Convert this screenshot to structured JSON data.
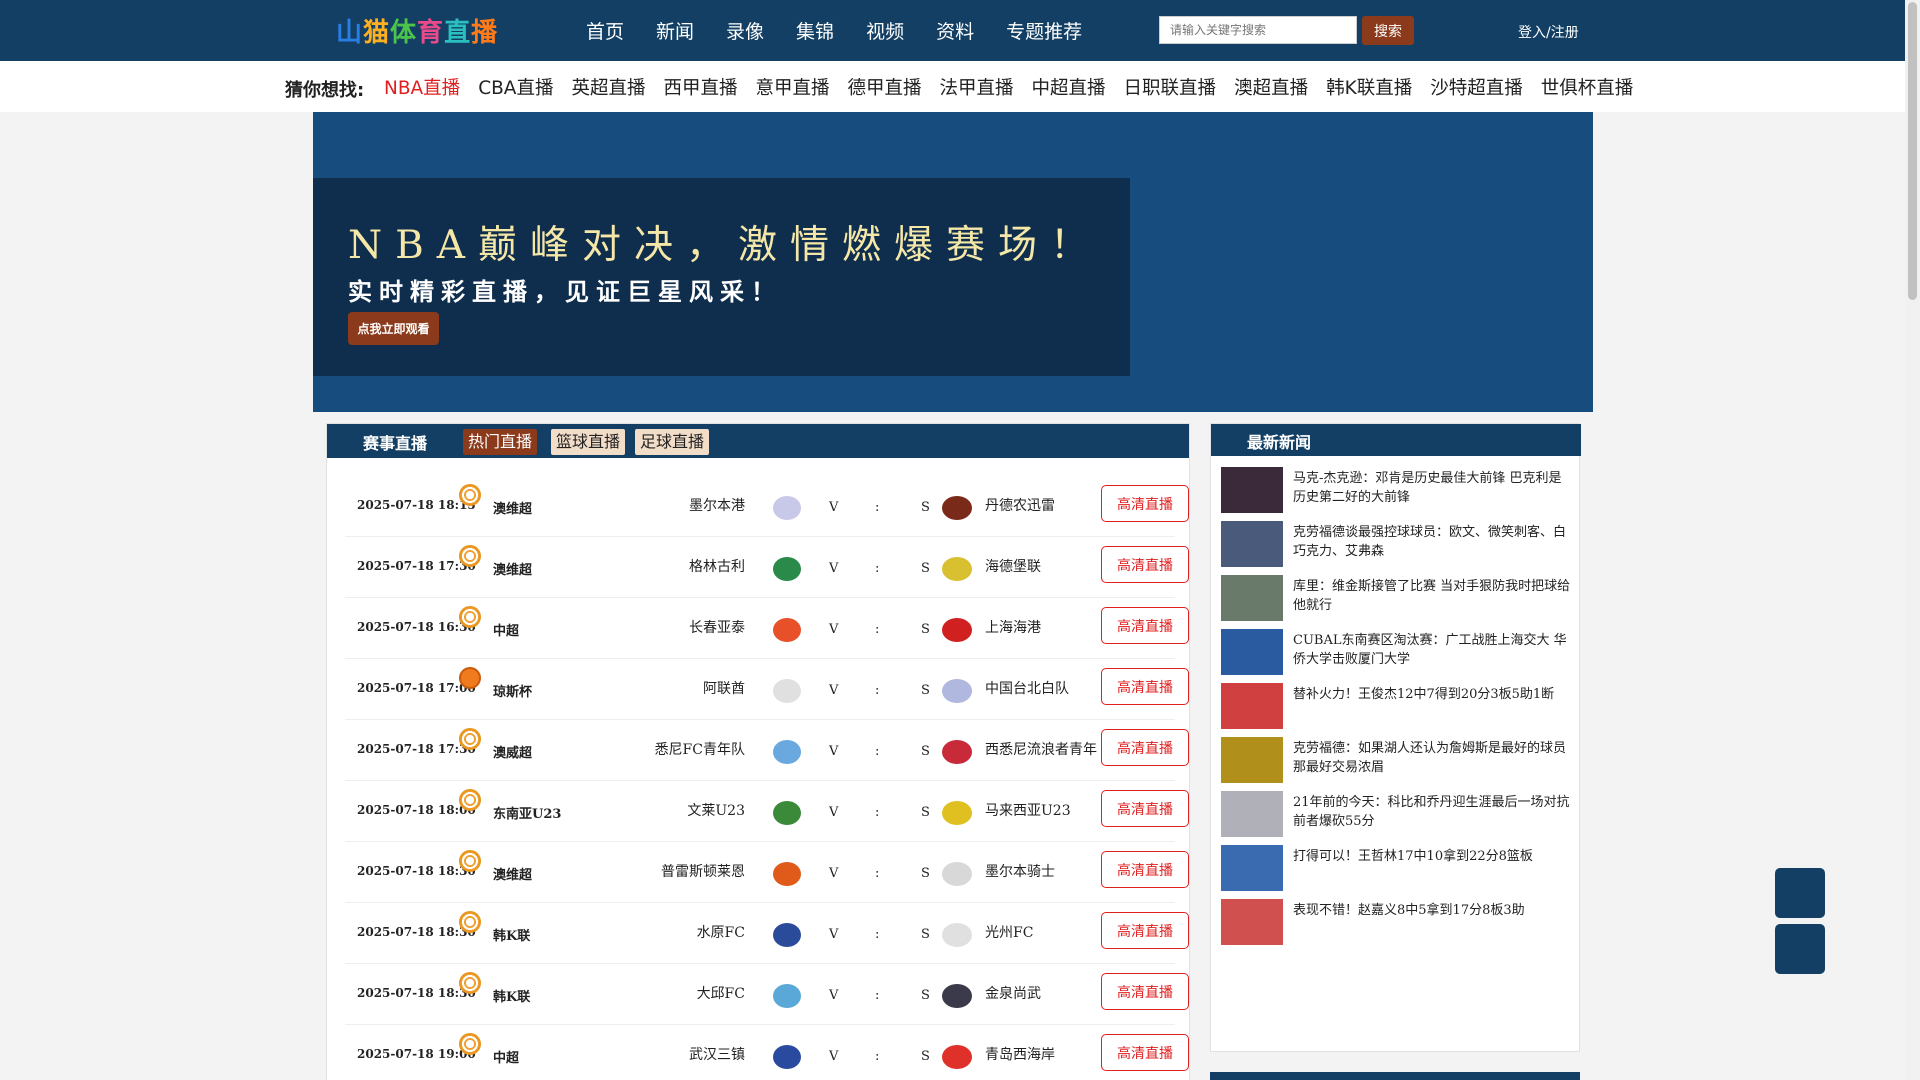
{
  "header": {
    "logo": "山猫体育直播",
    "logo_colors": [
      "#2a7de1",
      "#ffb020",
      "#4cc44c",
      "#e84a8a",
      "#2ac0c0",
      "#ff7a1a"
    ],
    "nav": [
      "首页",
      "新闻",
      "录像",
      "集锦",
      "视频",
      "资料",
      "专题推荐"
    ],
    "search_placeholder": "请输入关键字搜索",
    "search_button": "搜索",
    "login": "登入/注册"
  },
  "guess": {
    "label": "猜你想找:",
    "links": [
      "NBA直播",
      "CBA直播",
      "英超直播",
      "西甲直播",
      "意甲直播",
      "德甲直播",
      "法甲直播",
      "中超直播",
      "日职联直播",
      "澳超直播",
      "韩K联直播",
      "沙特超直播",
      "世俱杯直播"
    ]
  },
  "banner": {
    "headline": "NBA巅峰对决，激情燃爆赛场！",
    "subline": "实时精彩直播，见证巨星风采！",
    "button": "点我立即观看"
  },
  "matches": {
    "title": "赛事直播",
    "tabs": [
      "热门直播",
      "篮球直播",
      "足球直播"
    ],
    "rows": [
      {
        "time": "2025-07-18 18:15",
        "sport": "football",
        "league": "澳维超",
        "home": "墨尔本港",
        "away": "丹德农迅雷",
        "v": "V",
        "colon": ":",
        "s": "S",
        "btn": "高清直播",
        "hcolor": "#c8c8e8",
        "acolor": "#7a2a18"
      },
      {
        "time": "2025-07-18 17:30",
        "sport": "football",
        "league": "澳维超",
        "home": "格林古利",
        "away": "海德堡联",
        "v": "V",
        "colon": ":",
        "s": "S",
        "btn": "高清直播",
        "hcolor": "#2a8a4a",
        "acolor": "#d8c030"
      },
      {
        "time": "2025-07-18 16:30",
        "sport": "football",
        "league": "中超",
        "home": "长春亚泰",
        "away": "上海海港",
        "v": "V",
        "colon": ":",
        "s": "S",
        "btn": "高清直播",
        "hcolor": "#e8502a",
        "acolor": "#d02020"
      },
      {
        "time": "2025-07-18 17:00",
        "sport": "basket",
        "league": "琼斯杯",
        "home": "阿联酋",
        "away": "中国台北白队",
        "v": "V",
        "colon": ":",
        "s": "S",
        "btn": "高清直播",
        "hcolor": "#e0e0e0",
        "acolor": "#b0b8e0"
      },
      {
        "time": "2025-07-18 17:30",
        "sport": "football",
        "league": "澳威超",
        "home": "悉尼FC青年队",
        "away": "西悉尼流浪者青年",
        "v": "V",
        "colon": ":",
        "s": "S",
        "btn": "高清直播",
        "hcolor": "#6aa8e0",
        "acolor": "#c82a3a"
      },
      {
        "time": "2025-07-18 18:00",
        "sport": "football",
        "league": "东南亚U23",
        "home": "文莱U23",
        "away": "马来西亚U23",
        "v": "V",
        "colon": ":",
        "s": "S",
        "btn": "高清直播",
        "hcolor": "#3a8a3a",
        "acolor": "#e0c020"
      },
      {
        "time": "2025-07-18 18:30",
        "sport": "football",
        "league": "澳维超",
        "home": "普雷斯顿莱恩",
        "away": "墨尔本骑士",
        "v": "V",
        "colon": ":",
        "s": "S",
        "btn": "高清直播",
        "hcolor": "#e05a1a",
        "acolor": "#d8d8d8"
      },
      {
        "time": "2025-07-18 18:30",
        "sport": "football",
        "league": "韩K联",
        "home": "水原FC",
        "away": "光州FC",
        "v": "V",
        "colon": ":",
        "s": "S",
        "btn": "高清直播",
        "hcolor": "#2a4a9a",
        "acolor": "#e0e0e0"
      },
      {
        "time": "2025-07-18 18:30",
        "sport": "football",
        "league": "韩K联",
        "home": "大邱FC",
        "away": "金泉尚武",
        "v": "V",
        "colon": ":",
        "s": "S",
        "btn": "高清直播",
        "hcolor": "#5aa8d8",
        "acolor": "#3a3a4a"
      },
      {
        "time": "2025-07-18 19:00",
        "sport": "football",
        "league": "中超",
        "home": "武汉三镇",
        "away": "青岛西海岸",
        "v": "V",
        "colon": ":",
        "s": "S",
        "btn": "高清直播",
        "hcolor": "#2a4aa0",
        "acolor": "#e0302a"
      }
    ]
  },
  "news": {
    "title": "最新新闻",
    "items": [
      {
        "text": "马克-杰克逊：邓肯是历史最佳大前锋 巴克利是历史第二好的大前锋",
        "thumb": "#3a2a3a"
      },
      {
        "text": "克劳福德谈最强控球球员：欧文、微笑刺客、白巧克力、艾弗森",
        "thumb": "#4a5a7a"
      },
      {
        "text": "库里：维金斯接管了比赛 当对手狠防我时把球给他就行",
        "thumb": "#6a7a6a"
      },
      {
        "text": "CUBAL东南赛区淘汰赛：广工战胜上海交大 华侨大学击败厦门大学",
        "thumb": "#2a5aa0"
      },
      {
        "text": "替补火力！王俊杰12中7得到20分3板5助1断",
        "thumb": "#d04040"
      },
      {
        "text": "克劳福德：如果湖人还认为詹姆斯是最好的球员那最好交易浓眉",
        "thumb": "#b0901a"
      },
      {
        "text": "21年前的今天：科比和乔丹迎生涯最后一场对抗 前者爆砍55分",
        "thumb": "#b0b0b8"
      },
      {
        "text": "打得可以！王哲林17中10拿到22分8篮板",
        "thumb": "#3a6ab0"
      },
      {
        "text": "表现不错！赵嘉义8中5拿到17分8板3助",
        "thumb": "#d05050"
      }
    ]
  }
}
